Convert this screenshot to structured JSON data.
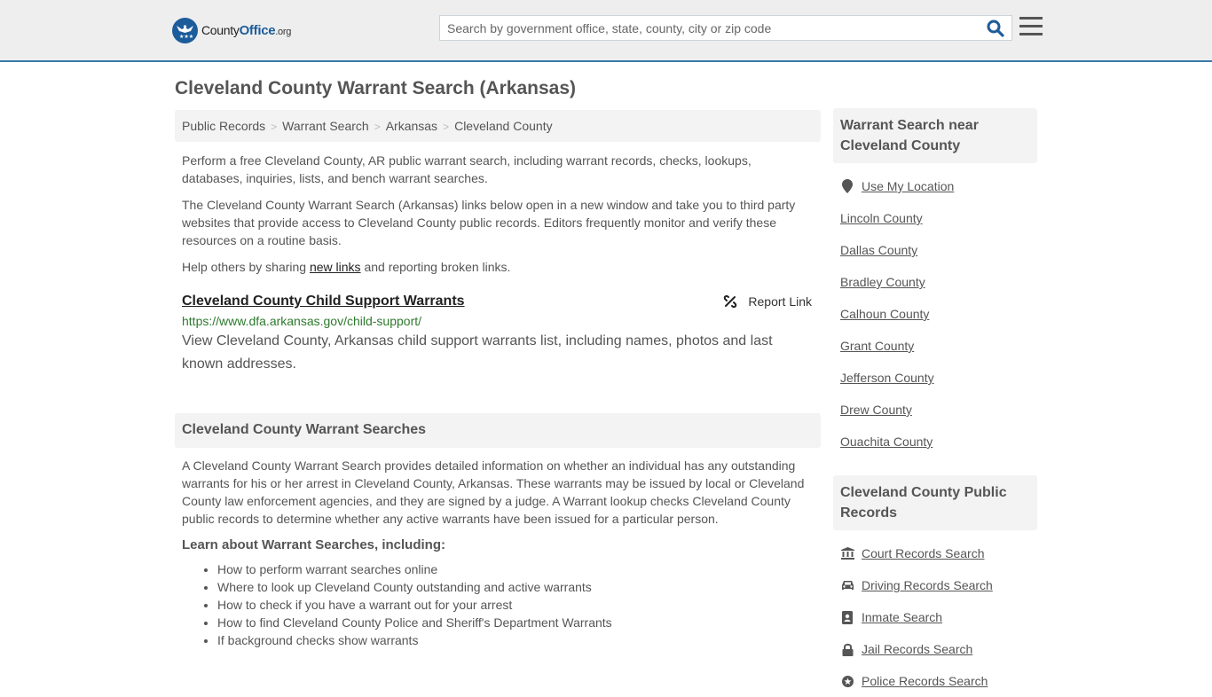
{
  "header": {
    "logo": {
      "name": "County",
      "office": "Office",
      "tld": ".org"
    },
    "search": {
      "placeholder": "Search by government office, state, county, city or zip code",
      "value": ""
    },
    "search_icon": "search-icon",
    "menu_icon": "hamburger-menu-icon"
  },
  "page": {
    "title": "Cleveland County Warrant Search (Arkansas)"
  },
  "breadcrumb": [
    {
      "label": "Public Records"
    },
    {
      "label": "Warrant Search"
    },
    {
      "label": "Arkansas"
    },
    {
      "label": "Cleveland County"
    }
  ],
  "breadcrumb_separator": ">",
  "intro": {
    "p1": "Perform a free Cleveland County, AR public warrant search, including warrant records, checks, lookups, databases, inquiries, lists, and bench warrant searches.",
    "p2": "The Cleveland County Warrant Search (Arkansas) links below open in a new window and take you to third party websites that provide access to Cleveland County public records. Editors frequently monitor and verify these resources on a routine basis.",
    "p3_before": "Help others by sharing ",
    "p3_link": "new links",
    "p3_after": " and reporting broken links."
  },
  "results": [
    {
      "title": "Cleveland County Child Support Warrants",
      "url": "https://www.dfa.arkansas.gov/child-support/",
      "description": "View Cleveland County, Arkansas child support warrants list, including names, photos and last known addresses.",
      "report_label": "Report Link"
    }
  ],
  "section": {
    "heading": "Cleveland County Warrant Searches",
    "body": "A Cleveland County Warrant Search provides detailed information on whether an individual has any outstanding warrants for his or her arrest in Cleveland County, Arkansas. These warrants may be issued by local or Cleveland County law enforcement agencies, and they are signed by a judge. A Warrant lookup checks Cleveland County public records to determine whether any active warrants have been issued for a particular person.",
    "learn_heading": "Learn about Warrant Searches, including:",
    "learn_items": [
      "How to perform warrant searches online",
      "Where to look up Cleveland County outstanding and active warrants",
      "How to check if you have a warrant out for your arrest",
      "How to find Cleveland County Police and Sheriff's Department Warrants",
      "If background checks show warrants"
    ]
  },
  "sidebar": {
    "nearby_heading": "Warrant Search near Cleveland County",
    "use_location": "Use My Location",
    "nearby": [
      "Lincoln County",
      "Dallas County",
      "Bradley County",
      "Calhoun County",
      "Grant County",
      "Jefferson County",
      "Drew County",
      "Ouachita County"
    ],
    "records_heading": "Cleveland County Public Records",
    "records": [
      {
        "label": "Court Records Search",
        "icon": "courthouse-icon"
      },
      {
        "label": "Driving Records Search",
        "icon": "car-icon"
      },
      {
        "label": "Inmate Search",
        "icon": "id-badge-icon"
      },
      {
        "label": "Jail Records Search",
        "icon": "lock-icon"
      },
      {
        "label": "Police Records Search",
        "icon": "police-badge-icon"
      }
    ]
  },
  "colors": {
    "brand_blue": "#1d5c9b",
    "header_border": "#3a79a8",
    "url_green": "#2d7a2d",
    "panel_gray": "#f3f3f3"
  }
}
